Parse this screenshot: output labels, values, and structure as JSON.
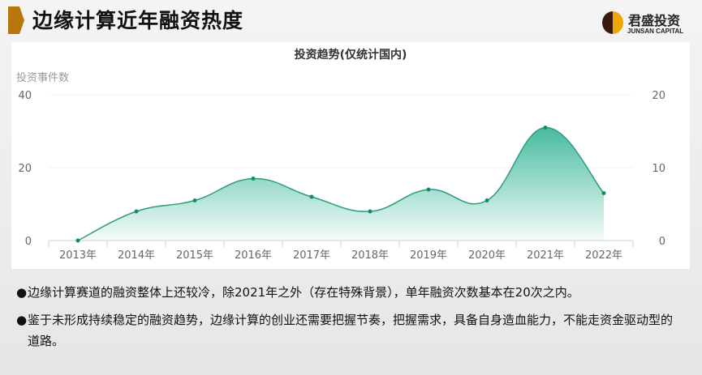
{
  "header": {
    "title": "边缘计算近年融资热度",
    "logo_cn": "君盛投资",
    "logo_en": "JUNSAN CAPITAL"
  },
  "chart_data": {
    "type": "area",
    "title": "投资趋势(仅统计国内)",
    "ylabel": "投资事件数",
    "categories": [
      "2013年",
      "2014年",
      "2015年",
      "2016年",
      "2017年",
      "2018年",
      "2019年",
      "2020年",
      "2021年",
      "2022年"
    ],
    "values": [
      0,
      8,
      11,
      17,
      12,
      8,
      14,
      11,
      31,
      13
    ],
    "ylim": [
      0,
      40
    ],
    "yticks": [
      "0",
      "20",
      "40"
    ],
    "y2lim": [
      0,
      20
    ],
    "y2ticks": [
      "0",
      "10",
      "20"
    ],
    "color": "#2a9d7f",
    "grid": true
  },
  "bullets": [
    "边缘计算赛道的融资整体上还较冷，除2021年之外（存在特殊背景），单年融资次数基本在20次之内。",
    "鉴于未形成持续稳定的融资趋势，边缘计算的创业还需要把握节奏，把握需求，具备自身造血能力，不能走资金驱动型的道路。"
  ],
  "bullet_symbol": "●"
}
